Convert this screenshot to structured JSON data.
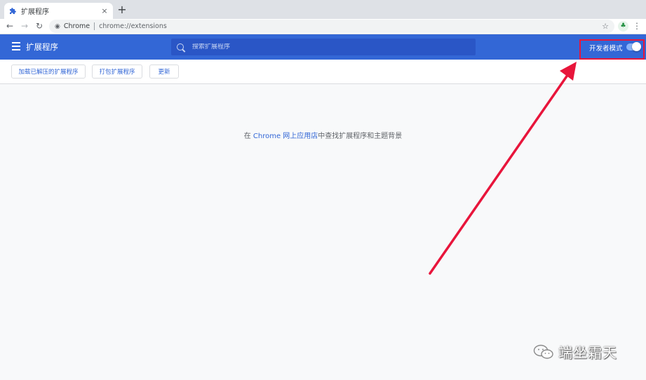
{
  "browser": {
    "tab": {
      "title": "扩展程序",
      "close": "×"
    },
    "new_tab": "+",
    "omnibox": {
      "site_label": "Chrome",
      "url": "chrome://extensions"
    },
    "nav": {
      "back": "←",
      "forward": "→",
      "reload": "↻",
      "star": "☆",
      "menu": "⋮",
      "profile": "♣"
    }
  },
  "header": {
    "title": "扩展程序",
    "search_placeholder": "搜索扩展程序",
    "developer_mode_label": "开发者模式",
    "developer_mode_on": true,
    "accent_color": "#3367d6"
  },
  "sub_toolbar": {
    "load_unpacked": "加载已解压的扩展程序",
    "pack_extension": "打包扩展程序",
    "update": "更新"
  },
  "main": {
    "message_prefix": "在",
    "store_link": "Chrome 网上应用店",
    "message_suffix": "中查找扩展程序和主题背景"
  },
  "annotation": {
    "highlight_color": "#e8153b"
  },
  "watermark": {
    "text": "端坐霜天"
  }
}
